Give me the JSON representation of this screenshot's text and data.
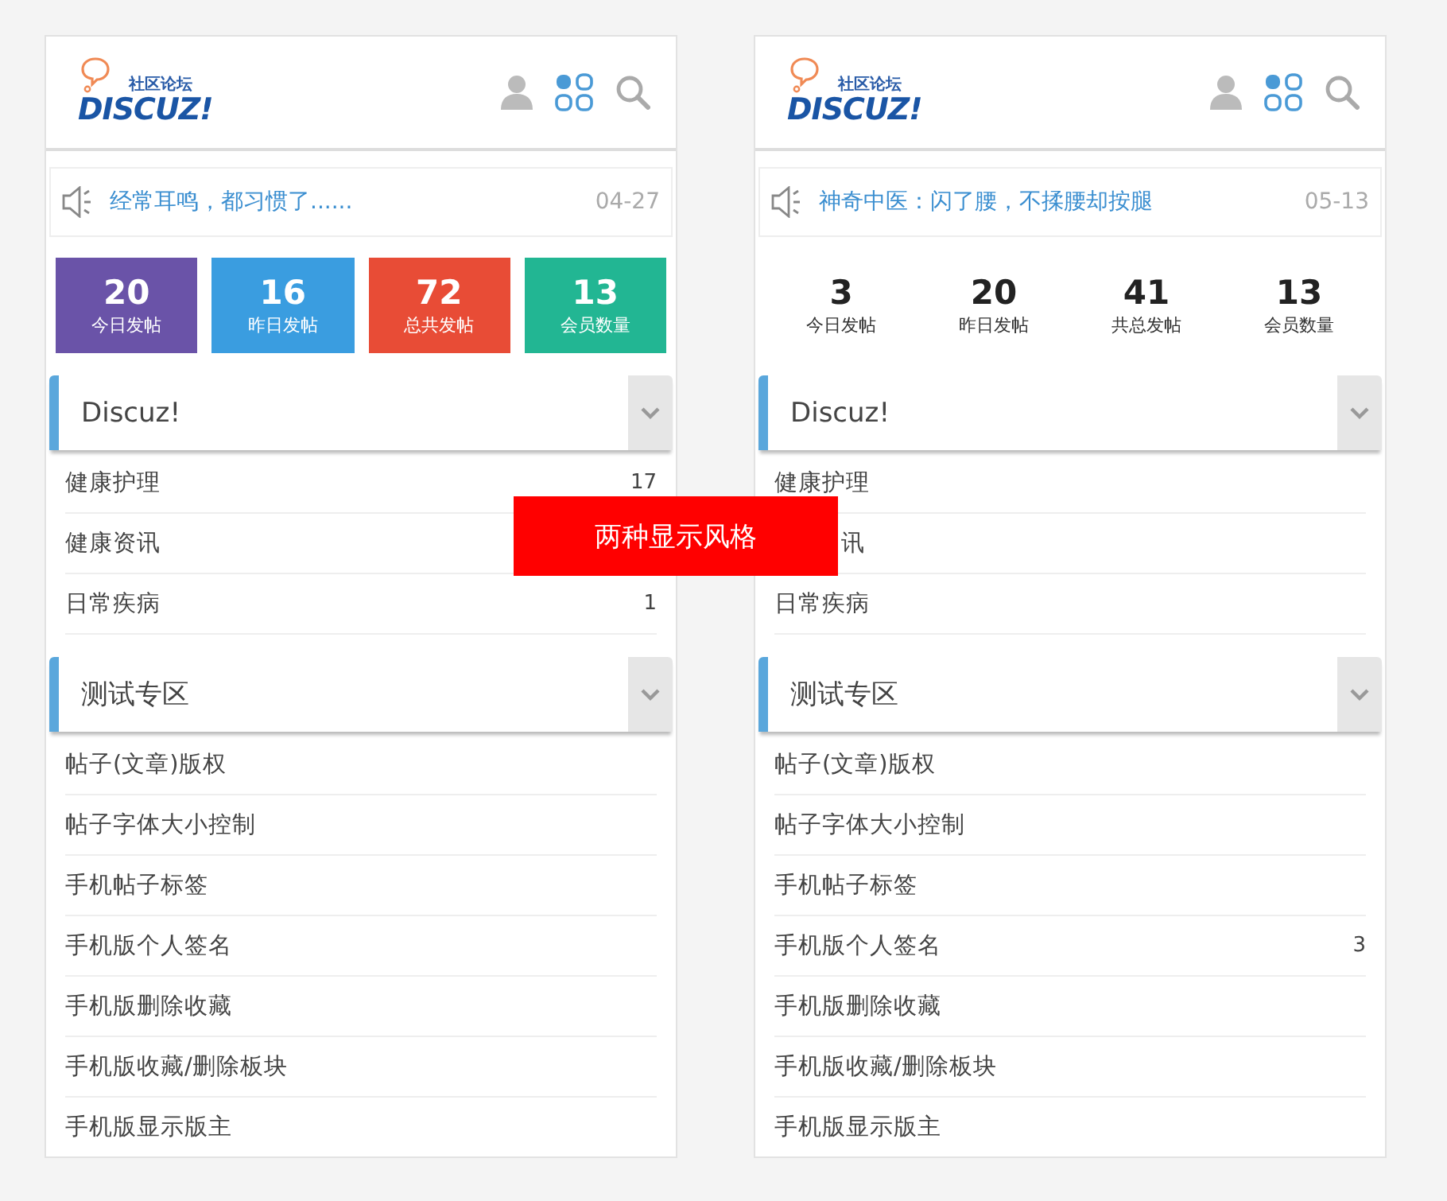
{
  "panels": [
    {
      "logo": {
        "tagline": "社区论坛",
        "wordmark": "DISCUZ!"
      },
      "notice": {
        "text": "经常耳鸣，都习惯了......",
        "date": "04-27"
      },
      "stats": {
        "kind": "tiles",
        "items": [
          {
            "value": "20",
            "label": "今日发帖",
            "color": "#6a53a8"
          },
          {
            "value": "16",
            "label": "昨日发帖",
            "color": "#3a9de0"
          },
          {
            "value": "72",
            "label": "总共发帖",
            "color": "#e84c36"
          },
          {
            "value": "13",
            "label": "会员数量",
            "color": "#22b693"
          }
        ]
      },
      "sections": [
        {
          "title": "Discuz!",
          "forums": [
            {
              "name": "健康护理",
              "count": "17"
            },
            {
              "name": "健康资讯"
            },
            {
              "name": "日常疾病",
              "count": "1"
            }
          ]
        },
        {
          "title": "测试专区",
          "forums": [
            {
              "name": "帖子(文章)版权"
            },
            {
              "name": "帖子字体大小控制"
            },
            {
              "name": "手机帖子标签"
            },
            {
              "name": "手机版个人签名"
            },
            {
              "name": "手机版删除收藏"
            },
            {
              "name": "手机版收藏/删除板块"
            },
            {
              "name": "手机版显示版主"
            }
          ]
        }
      ]
    },
    {
      "logo": {
        "tagline": "社区论坛",
        "wordmark": "DISCUZ!"
      },
      "notice": {
        "text": "神奇中医：闪了腰，不揉腰却按腿",
        "date": "05-13"
      },
      "stats": {
        "kind": "plain",
        "items": [
          {
            "value": "3",
            "label": "今日发帖"
          },
          {
            "value": "20",
            "label": "昨日发帖"
          },
          {
            "value": "41",
            "label": "共总发帖"
          },
          {
            "value": "13",
            "label": "会员数量"
          }
        ]
      },
      "sections": [
        {
          "title": "Discuz!",
          "forums": [
            {
              "name": "健康护理"
            },
            {
              "name": "讯",
              "cut": true
            },
            {
              "name": "日常疾病"
            }
          ]
        },
        {
          "title": "测试专区",
          "forums": [
            {
              "name": "帖子(文章)版权"
            },
            {
              "name": "帖子字体大小控制"
            },
            {
              "name": "手机帖子标签"
            },
            {
              "name": "手机版个人签名",
              "count": "3"
            },
            {
              "name": "手机版删除收藏"
            },
            {
              "name": "手机版收藏/删除板块"
            },
            {
              "name": "手机版显示版主"
            }
          ]
        }
      ]
    }
  ],
  "banner": {
    "text": "两种显示风格"
  }
}
